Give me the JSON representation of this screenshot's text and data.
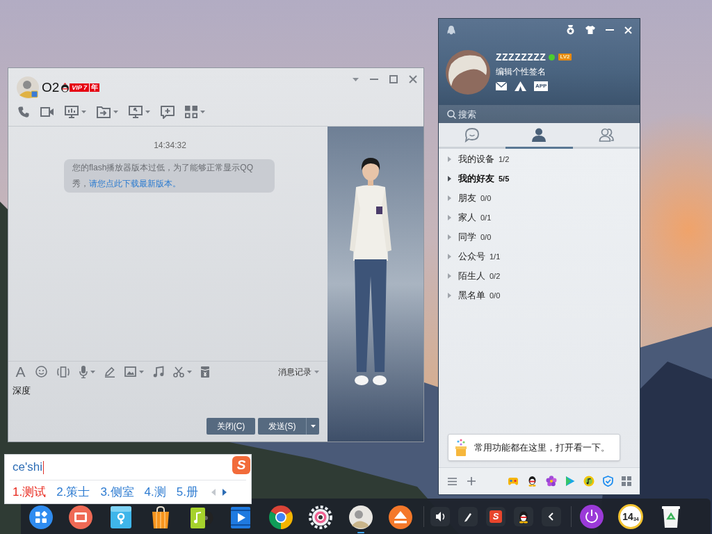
{
  "chat_window": {
    "contact_name": "O2",
    "vip_level": "VIP 7",
    "vip_suffix": "年",
    "timestamp": "14:34:32",
    "message": {
      "text": "您的flash播放器版本过低，为了能够正常显示QQ秀，",
      "link": "请您点此下载最新版本。"
    },
    "font_button": "A",
    "history_label": "消息记录",
    "input": {
      "value": "深度"
    },
    "close_button": "关闭(C)",
    "send_button": "发送(S)"
  },
  "ime": {
    "composition": "ce'shi",
    "logo": "S",
    "candidates": [
      {
        "label": "1.测试",
        "selected": true
      },
      {
        "label": "2.策士",
        "selected": false
      },
      {
        "label": "3.侧室",
        "selected": false
      },
      {
        "label": "4.测",
        "selected": false
      },
      {
        "label": "5.册",
        "selected": false
      }
    ],
    "prev_disabled": true,
    "next_disabled": false
  },
  "qq_panel": {
    "nickname": "ZZZZZZZZ",
    "online": true,
    "level_badge": "LV2",
    "signature": "编辑个性签名",
    "app_label": "APP",
    "search": {
      "placeholder": "搜索"
    },
    "tabs": [
      {
        "kind": "chats",
        "selected": false
      },
      {
        "kind": "contacts",
        "selected": true
      },
      {
        "kind": "groups",
        "selected": false
      }
    ],
    "groups": [
      {
        "name": "我的设备",
        "count": "1/2",
        "expanded": false,
        "selected": false
      },
      {
        "name": "我的好友",
        "count": "5/5",
        "expanded": false,
        "selected": true
      },
      {
        "name": "朋友",
        "count": "0/0",
        "expanded": false,
        "selected": false
      },
      {
        "name": "家人",
        "count": "0/1",
        "expanded": false,
        "selected": false
      },
      {
        "name": "同学",
        "count": "0/0",
        "expanded": false,
        "selected": false
      },
      {
        "name": "公众号",
        "count": "1/1",
        "expanded": false,
        "selected": false
      },
      {
        "name": "陌生人",
        "count": "0/2",
        "expanded": false,
        "selected": false
      },
      {
        "name": "黑名单",
        "count": "0/0",
        "expanded": false,
        "selected": false
      }
    ],
    "tip": "常用功能都在这里，打开看一下。"
  },
  "dock": {
    "apps": [
      {
        "kind": "launcher",
        "running": false
      },
      {
        "kind": "video",
        "running": false
      },
      {
        "kind": "files",
        "running": false
      },
      {
        "kind": "store",
        "running": false
      },
      {
        "kind": "music",
        "running": false
      },
      {
        "kind": "movies",
        "running": false
      },
      {
        "kind": "browser",
        "running": false
      },
      {
        "kind": "settings",
        "running": false
      },
      {
        "kind": "avatar",
        "running": true
      },
      {
        "kind": "eject",
        "running": false
      }
    ],
    "tray": [
      {
        "kind": "volume"
      },
      {
        "kind": "pen"
      },
      {
        "kind": "ime",
        "label": "S"
      },
      {
        "kind": "qq"
      },
      {
        "kind": "expand"
      }
    ],
    "clock": {
      "hour": "14",
      "minute": "34"
    }
  }
}
